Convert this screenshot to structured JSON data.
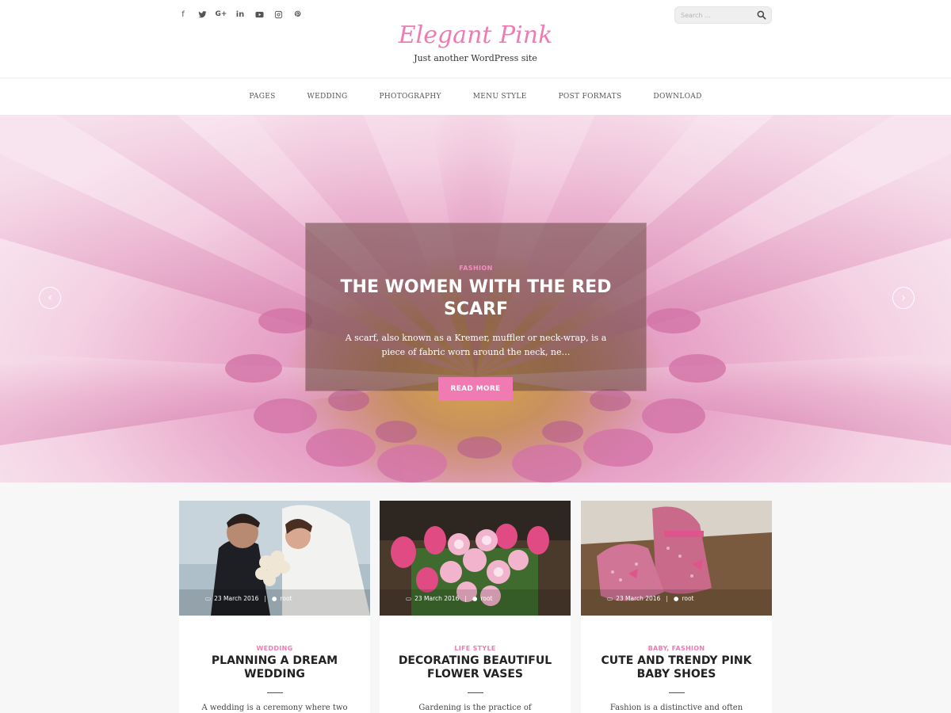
{
  "colors": {
    "accent": "#f07ab2",
    "header_bg": "#ffffff",
    "page_bg": "#f7f7f7"
  },
  "social": [
    {
      "name": "facebook",
      "glyph": "f"
    },
    {
      "name": "twitter",
      "glyph": ""
    },
    {
      "name": "google-plus",
      "glyph": "G+"
    },
    {
      "name": "linkedin",
      "glyph": "in"
    },
    {
      "name": "youtube",
      "glyph": ""
    },
    {
      "name": "instagram",
      "glyph": ""
    },
    {
      "name": "pinterest",
      "glyph": ""
    }
  ],
  "search": {
    "placeholder": "Search ..."
  },
  "site": {
    "title": "Elegant Pink",
    "tagline": "Just another WordPress site"
  },
  "nav": [
    "PAGES",
    "WEDDING",
    "PHOTOGRAPHY",
    "MENU STYLE",
    "POST FORMATS",
    "DOWNLOAD"
  ],
  "slider": {
    "category": "FASHION",
    "title": "THE WOMEN WITH THE RED SCARF",
    "excerpt": "A scarf, also known as a Kremer, muffler or neck-wrap, is a piece of fabric worn around the neck, ne…",
    "button": "READ MORE"
  },
  "posts": [
    {
      "date": "23 March 2016",
      "author": "root",
      "category": "WEDDING",
      "title": "PLANNING A DREAM WEDDING",
      "excerpt": "A wedding is a ceremony where two"
    },
    {
      "date": "23 March 2016",
      "author": "root",
      "category": "LIFE STYLE",
      "title": "DECORATING BEAUTIFUL FLOWER VASES",
      "excerpt": "Gardening is the practice of"
    },
    {
      "date": "23 March 2016",
      "author": "root",
      "category": "BABY, FASHION",
      "title": "CUTE AND TRENDY PINK BABY SHOES",
      "excerpt": "Fashion is a distinctive and often"
    }
  ]
}
